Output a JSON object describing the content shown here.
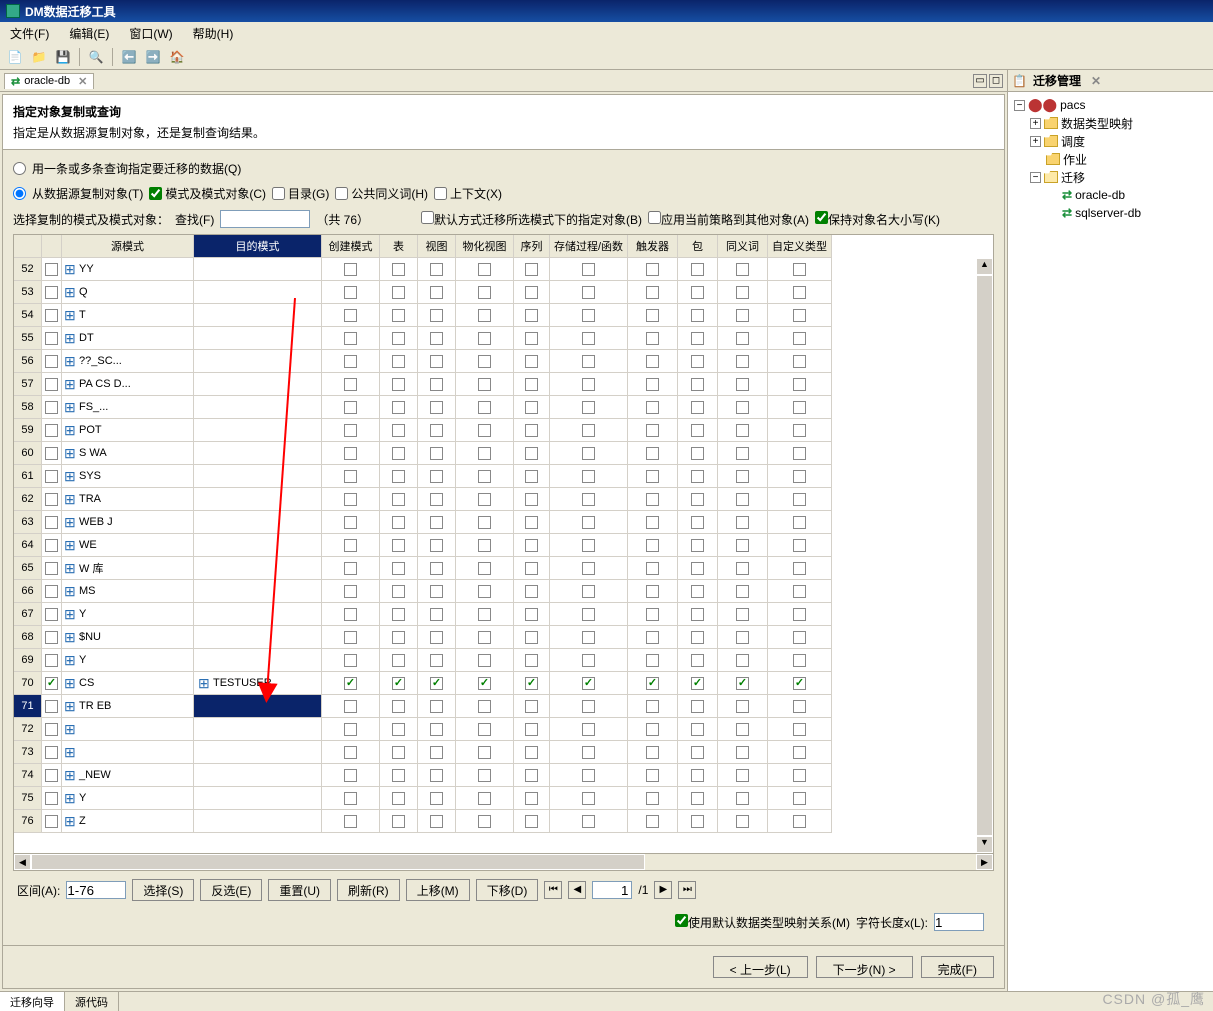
{
  "app_title": "DM数据迁移工具",
  "menus": {
    "file": "文件(F)",
    "edit": "编辑(E)",
    "window": "窗口(W)",
    "help": "帮助(H)"
  },
  "left_tab": {
    "title": "oracle-db"
  },
  "wizard": {
    "heading": "指定对象复制或查询",
    "subheading": "指定是从数据源复制对象，还是复制查询结果。",
    "radio_query": "用一条或多条查询指定要迁移的数据(Q)",
    "radio_copy": "从数据源复制对象(T)",
    "cb_schema": "模式及模式对象(C)",
    "cb_dir": "目录(G)",
    "cb_syn": "公共同义词(H)",
    "cb_ctx": "上下文(X)",
    "filter_label": "选择复制的模式及模式对象：",
    "find_label": "查找(F)",
    "total": "（共 76）",
    "cb_default": "默认方式迁移所选模式下的指定对象(B)",
    "cb_policy": "应用当前策略到其他对象(A)",
    "cb_case": "保持对象名大小写(K)"
  },
  "columns": [
    "",
    "",
    "源模式",
    "目的模式",
    "创建模式",
    "表",
    "视图",
    "物化视图",
    "序列",
    "存储过程/函数",
    "触发器",
    "包",
    "同义词",
    "自定义类型"
  ],
  "rows": [
    {
      "n": 52,
      "src": "YY"
    },
    {
      "n": 53,
      "src": "Q"
    },
    {
      "n": 54,
      "src": "T"
    },
    {
      "n": 55,
      "src": "DT"
    },
    {
      "n": 56,
      "src": "??_SC..."
    },
    {
      "n": 57,
      "src": "PA   CS   D..."
    },
    {
      "n": 58,
      "src": "FS_..."
    },
    {
      "n": 59,
      "src": "POT"
    },
    {
      "n": 60,
      "src": "S WA"
    },
    {
      "n": 61,
      "src": "SYS"
    },
    {
      "n": 62,
      "src": "TRA"
    },
    {
      "n": 63,
      "src": "WEB J"
    },
    {
      "n": 64,
      "src": "WE"
    },
    {
      "n": 65,
      "src": "W 库"
    },
    {
      "n": 66,
      "src": "MS"
    },
    {
      "n": 67,
      "src": "Y"
    },
    {
      "n": 68,
      "src": "$NU"
    },
    {
      "n": 69,
      "src": "Y"
    },
    {
      "n": 70,
      "src": "CS",
      "dest": "TESTUSER",
      "checked": true
    },
    {
      "n": 71,
      "src": "TR EB",
      "selected": true
    },
    {
      "n": 72,
      "src": ""
    },
    {
      "n": 73,
      "src": ""
    },
    {
      "n": 74,
      "src": "_NEW"
    },
    {
      "n": 75,
      "src": "Y"
    },
    {
      "n": 76,
      "src": "Z"
    }
  ],
  "footer": {
    "range_label": "区间(A):",
    "range_value": "1-76",
    "btn_select": "选择(S)",
    "btn_invert": "反选(E)",
    "btn_reset": "重置(U)",
    "btn_refresh": "刷新(R)",
    "btn_up": "上移(M)",
    "btn_down": "下移(D)",
    "page": "1",
    "page_total": "/1",
    "cb_map": "使用默认数据类型映射关系(M)",
    "len_label": "字符长度x(L):",
    "len_val": "1",
    "btn_prev": "< 上一步(L)",
    "btn_next": "下一步(N) >",
    "btn_finish": "完成(F)"
  },
  "bottom_tabs": {
    "wizard": "迁移向导",
    "source": "源代码"
  },
  "right": {
    "title": "迁移管理",
    "root": "pacs",
    "n_types": "数据类型映射",
    "n_sched": "调度",
    "n_jobs": "作业",
    "n_mig": "迁移",
    "leaf1": "oracle-db",
    "leaf2": "sqlserver-db"
  },
  "watermark": "CSDN @孤_鹰"
}
